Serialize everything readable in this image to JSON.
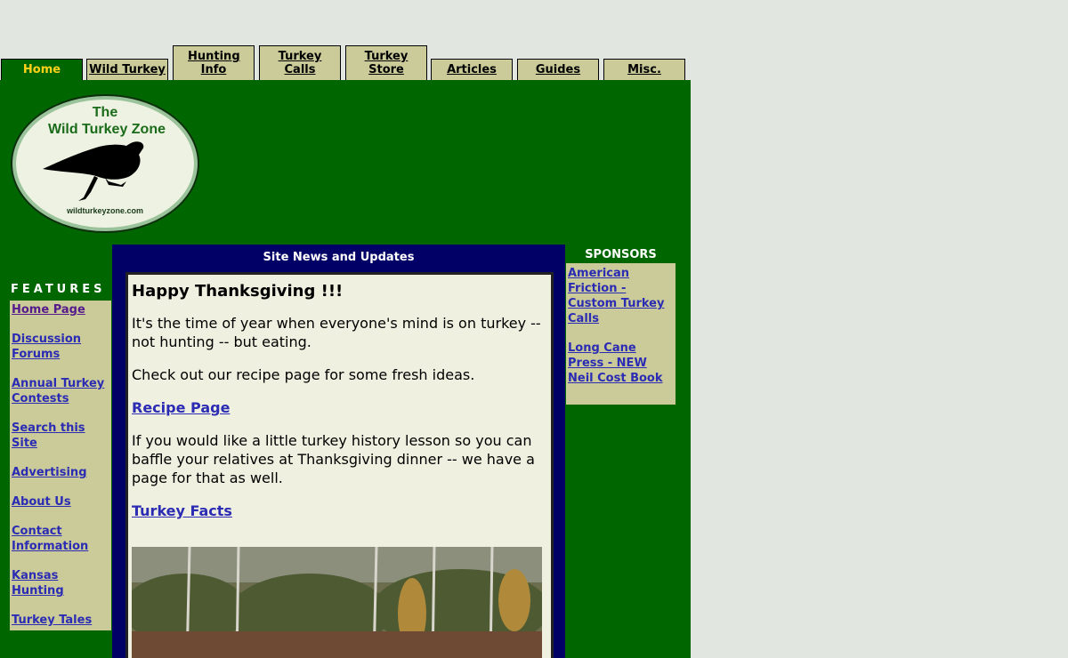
{
  "tabs": [
    {
      "label": "Home",
      "active": true
    },
    {
      "label": "Wild Turkey"
    },
    {
      "label": "Hunting Info"
    },
    {
      "label": "Turkey Calls"
    },
    {
      "label": "Turkey Store"
    },
    {
      "label": "Articles"
    },
    {
      "label": "Guides"
    },
    {
      "label": "Misc."
    }
  ],
  "logo": {
    "line1": "The",
    "line2": "Wild Turkey Zone",
    "url_text": "wildturkeyzone.com"
  },
  "features": {
    "title": "FEATURES",
    "items": [
      "Home Page",
      "Discussion Forums",
      "Annual Turkey Contests",
      "Search this Site",
      "Advertising",
      "About Us",
      "Contact Information",
      "Kansas Hunting",
      "Turkey Tales"
    ]
  },
  "news": {
    "title": "Site News and Updates",
    "heading": "Happy Thanksgiving !!!",
    "p1": "It's the time of year when everyone's mind is on turkey -- not hunting -- but eating.",
    "p2": "Check out our recipe page for some fresh ideas.",
    "link1": "Recipe Page",
    "p3": "If you would like a little turkey history lesson so you can baffle your relatives at Thanksgiving dinner -- we have a page for that as well.",
    "link2": "Turkey Facts"
  },
  "sponsors": {
    "title": "SPONSORS",
    "items": [
      "American Friction - Custom Turkey Calls",
      "Long Cane Press - NEW Neil Cost Book"
    ]
  },
  "colors": {
    "page_green": "#006600",
    "panel_tan": "#cacb98",
    "navy": "#000066",
    "link_blue": "#2b2bb4",
    "active_tab_text": "#ffd21a"
  }
}
